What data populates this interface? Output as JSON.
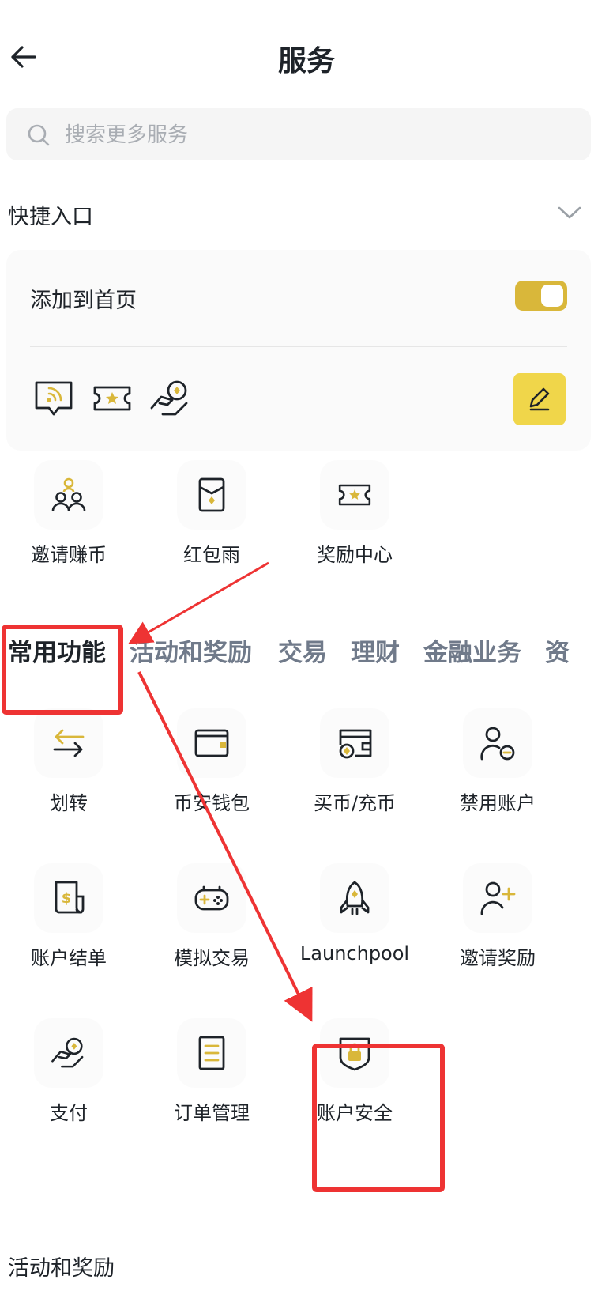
{
  "header": {
    "title": "服务",
    "back_icon": "back-arrow-icon"
  },
  "search": {
    "placeholder": "搜索更多服务",
    "value": ""
  },
  "quick_entry": {
    "title": "快捷入口",
    "add_to_home_label": "添加到首页",
    "toggle_on": true,
    "icons": [
      "broadcast-icon",
      "reward-ticket-icon",
      "pay-hand-icon"
    ],
    "edit_icon": "edit-pencil-icon"
  },
  "shortcuts": [
    {
      "label": "邀请赚币",
      "icon": "invite-people-icon"
    },
    {
      "label": "红包雨",
      "icon": "red-envelope-icon"
    },
    {
      "label": "奖励中心",
      "icon": "reward-ticket-icon"
    }
  ],
  "tabs": [
    {
      "label": "常用功能",
      "active": true
    },
    {
      "label": "活动和奖励",
      "active": false
    },
    {
      "label": "交易",
      "active": false
    },
    {
      "label": "理财",
      "active": false
    },
    {
      "label": "金融业务",
      "active": false
    },
    {
      "label": "资",
      "active": false
    }
  ],
  "common_functions": [
    {
      "label": "划转",
      "icon": "transfer-arrows-icon"
    },
    {
      "label": "币安钱包",
      "icon": "wallet-icon"
    },
    {
      "label": "买币/充币",
      "icon": "buy-crypto-icon"
    },
    {
      "label": "禁用账户",
      "icon": "disable-account-icon"
    },
    {
      "label": "账户结单",
      "icon": "statement-dollar-icon"
    },
    {
      "label": "模拟交易",
      "icon": "gamepad-icon"
    },
    {
      "label": "Launchpool",
      "icon": "rocket-icon"
    },
    {
      "label": "邀请奖励",
      "icon": "add-user-icon"
    },
    {
      "label": "支付",
      "icon": "pay-hand-icon"
    },
    {
      "label": "订单管理",
      "icon": "order-list-icon"
    },
    {
      "label": "账户安全",
      "icon": "shield-lock-icon"
    }
  ],
  "next_section_title": "活动和奖励",
  "colors": {
    "accent": "#d9b73a",
    "edit_bg": "#f0d64a",
    "annotation": "#ee3333",
    "text": "#1e2329",
    "muted": "#707a8a"
  }
}
